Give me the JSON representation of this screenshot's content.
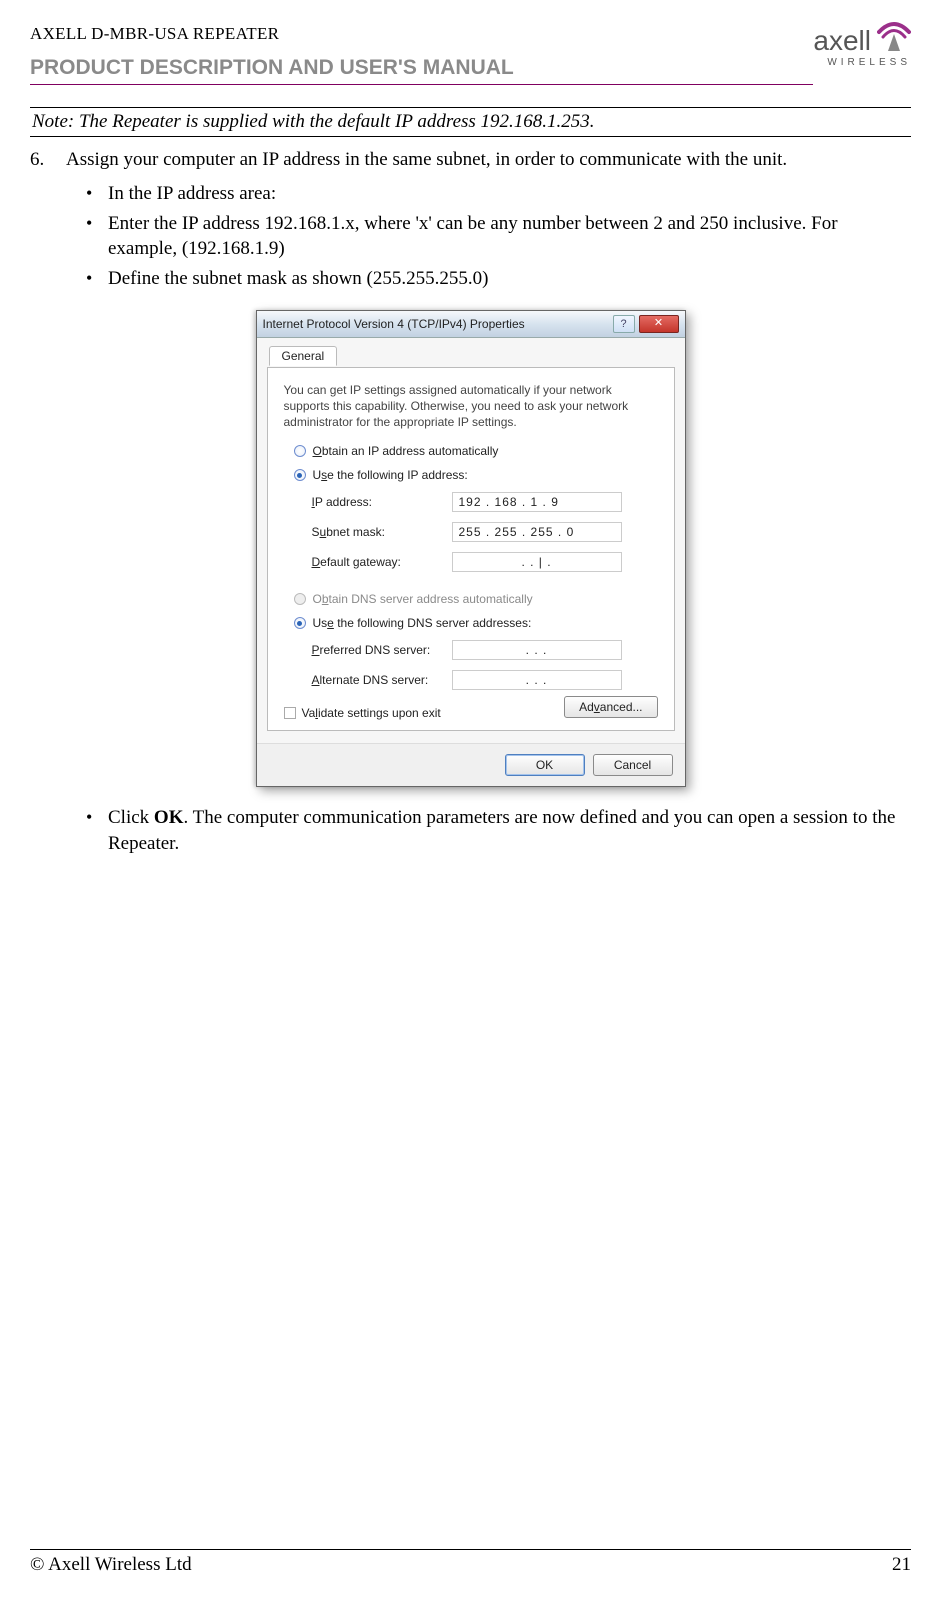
{
  "header": {
    "doc_title": "AXELL D-MBR-USA REPEATER",
    "section_heading": "PRODUCT DESCRIPTION AND USER'S MANUAL",
    "brand": "axell",
    "brand_sub": "WIRELESS"
  },
  "note": {
    "text": "Note:  The Repeater is supplied with the default IP address 192.168.1.253."
  },
  "step": {
    "number": "6.",
    "text": "Assign your computer an IP address in the same subnet, in order to communicate with the unit."
  },
  "pre_bullets": {
    "items": [
      "In the IP address area:",
      "Enter the IP address 192.168.1.x, where 'x' can be any number between 2 and 250 inclusive. For example,  (192.168.1.9)",
      "Define the subnet mask as shown (255.255.255.0)"
    ]
  },
  "dialog": {
    "title": "Internet Protocol Version 4 (TCP/IPv4) Properties",
    "help_glyph": "?",
    "close_glyph": "✕",
    "tab": "General",
    "description": "You can get IP settings assigned automatically if your network supports this capability. Otherwise, you need to ask your network administrator for the appropriate IP settings.",
    "radios": {
      "ip_auto": "Obtain an IP address automatically",
      "ip_manual": "Use the following IP address:",
      "dns_auto": "Obtain DNS server address automatically",
      "dns_manual": "Use the following DNS server addresses:"
    },
    "fields": {
      "ip_label": "IP address:",
      "ip_value": "192 . 168 .  1   .   9",
      "subnet_label": "Subnet mask:",
      "subnet_value": "255 . 255 . 255 .  0",
      "gateway_label": "Default gateway:",
      "gateway_value": ".      .   |   .",
      "pref_dns_label": "Preferred DNS server:",
      "pref_dns_value": ".       .       .",
      "alt_dns_label": "Alternate DNS server:",
      "alt_dns_value": ".       .       ."
    },
    "validate_label": "Validate settings upon exit",
    "advanced_label": "Advanced...",
    "ok_label": "OK",
    "cancel_label": "Cancel"
  },
  "post_bullet": {
    "prefix": "Click ",
    "bold": "OK",
    "suffix": ". The computer communication parameters are now defined and you can open a session to the Repeater."
  },
  "footer": {
    "copyright": "© Axell Wireless Ltd",
    "page": "21"
  }
}
